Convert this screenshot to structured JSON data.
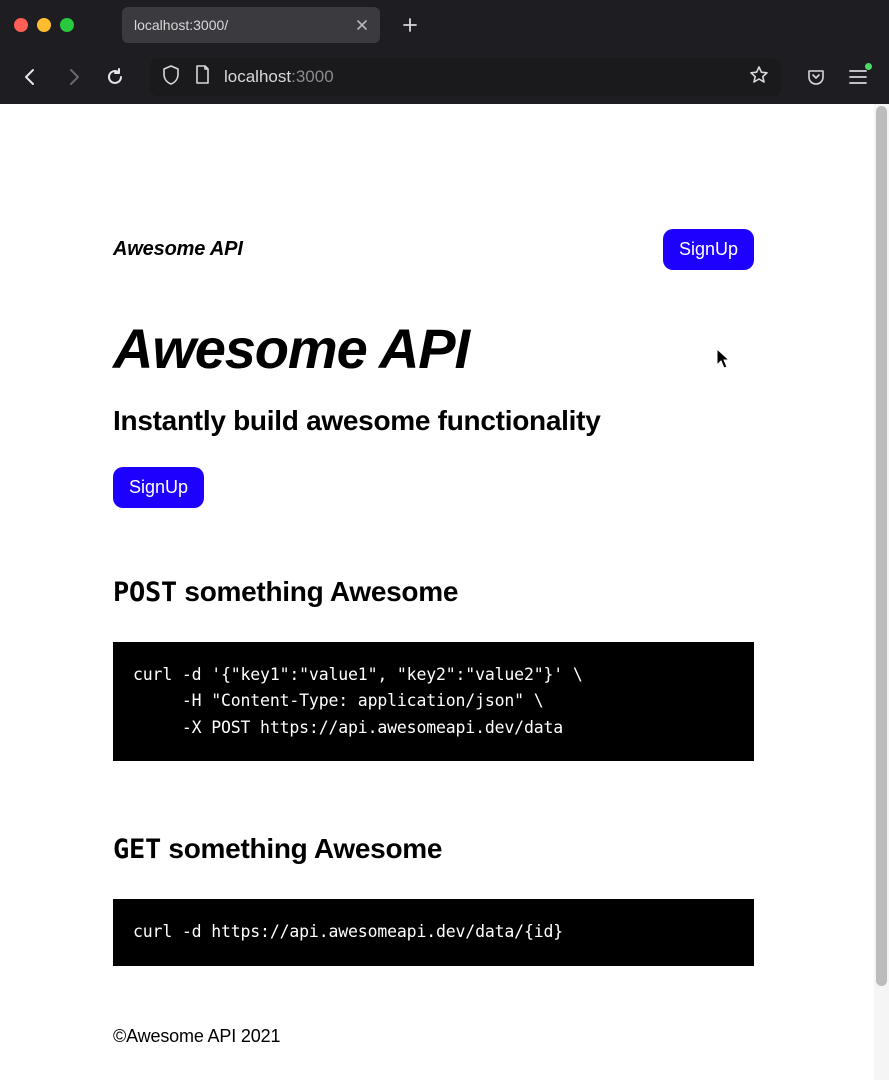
{
  "browser": {
    "tab_title": "localhost:3000/",
    "url_host": "localhost",
    "url_port": ":3000"
  },
  "nav": {
    "brand": "Awesome API",
    "signup_label": "SignUp"
  },
  "hero": {
    "title": "Awesome API",
    "subtitle": "Instantly build awesome functionality",
    "signup_label": "SignUp"
  },
  "sections": [
    {
      "method": "POST",
      "title_rest": " something Awesome",
      "code": "curl -d '{\"key1\":\"value1\", \"key2\":\"value2\"}' \\\n     -H \"Content-Type: application/json\" \\\n     -X POST https://api.awesomeapi.dev/data"
    },
    {
      "method": "GET",
      "title_rest": " something Awesome",
      "code": "curl -d https://api.awesomeapi.dev/data/{id}"
    }
  ],
  "footer": {
    "text": "©Awesome API 2021"
  }
}
